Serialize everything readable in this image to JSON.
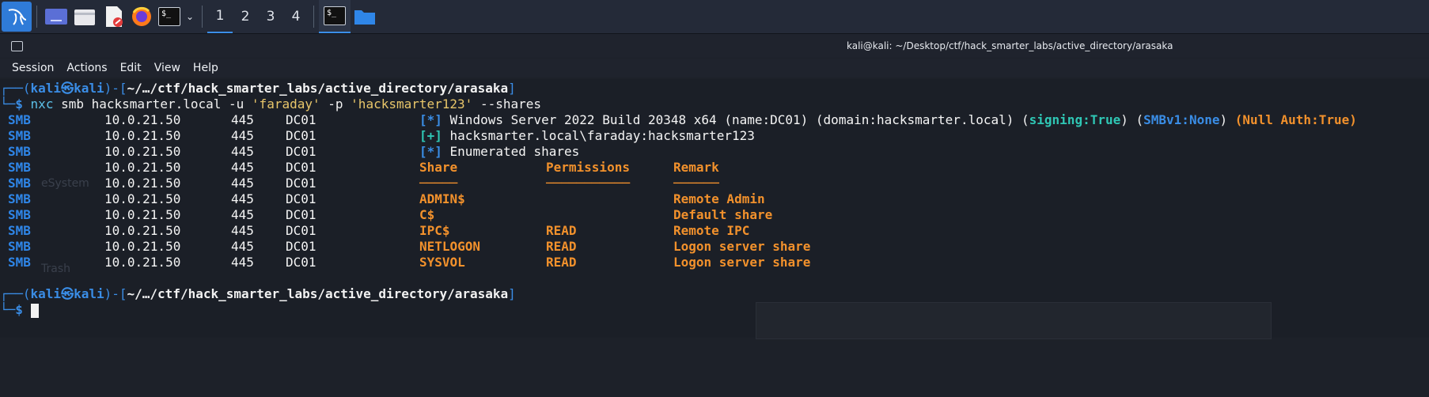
{
  "taskbar": {
    "apps": [
      {
        "name": "kali-menu-icon"
      },
      {
        "name": "show-desktop-icon"
      },
      {
        "name": "file-manager-icon"
      },
      {
        "name": "text-editor-icon"
      },
      {
        "name": "firefox-icon"
      },
      {
        "name": "terminal-icon"
      }
    ],
    "workspaces": [
      "1",
      "2",
      "3",
      "4"
    ],
    "active_workspace": "1",
    "terminal_mini_label": "$_"
  },
  "window": {
    "title": "kali@kali: ~/Desktop/ctf/hack_smarter_labs/active_directory/arasaka"
  },
  "menu": [
    "Session",
    "Actions",
    "Edit",
    "View",
    "Help"
  ],
  "terminal": {
    "prompt": {
      "user": "kali",
      "at": "㉿",
      "host": "kali",
      "path": "~/…/ctf/hack_smarter_labs/active_directory/arasaka",
      "dollar": "$"
    },
    "command": {
      "program": "nxc",
      "args_1": " smb hacksmarter.local ",
      "flag_u": "-u",
      "user_val": "'faraday'",
      "flag_p": "-p",
      "pass_val": "'hacksmarter123'",
      "flag_shares": "--shares"
    },
    "rows": [
      {
        "proto": "SMB",
        "ip": "10.0.21.50",
        "port": "445",
        "host": "DC01"
      },
      {
        "proto": "SMB",
        "ip": "10.0.21.50",
        "port": "445",
        "host": "DC01"
      },
      {
        "proto": "SMB",
        "ip": "10.0.21.50",
        "port": "445",
        "host": "DC01"
      },
      {
        "proto": "SMB",
        "ip": "10.0.21.50",
        "port": "445",
        "host": "DC01"
      },
      {
        "proto": "SMB",
        "ip": "10.0.21.50",
        "port": "445",
        "host": "DC01"
      },
      {
        "proto": "SMB",
        "ip": "10.0.21.50",
        "port": "445",
        "host": "DC01"
      },
      {
        "proto": "SMB",
        "ip": "10.0.21.50",
        "port": "445",
        "host": "DC01"
      },
      {
        "proto": "SMB",
        "ip": "10.0.21.50",
        "port": "445",
        "host": "DC01"
      },
      {
        "proto": "SMB",
        "ip": "10.0.21.50",
        "port": "445",
        "host": "DC01"
      },
      {
        "proto": "SMB",
        "ip": "10.0.21.50",
        "port": "445",
        "host": "DC01"
      }
    ],
    "info": {
      "tag_star": "[*]",
      "tag_plus": "[+]",
      "windows": " Windows Server 2022 Build 20348 x64 (name:DC01) (domain:hacksmarter.local) (",
      "signing": "signing:True",
      "mid": ") (",
      "smbv1": "SMBv1:None",
      "mid2": ") ",
      "null_auth": "(Null Auth:True)",
      "auth": " hacksmarter.local\\faraday:hacksmarter123",
      "enum": " Enumerated shares"
    },
    "share_header": {
      "share": "Share",
      "perm": "Permissions",
      "remark": "Remark"
    },
    "share_rule": {
      "share": "─────",
      "perm": "───────────",
      "remark": "──────"
    },
    "shares": [
      {
        "share": "ADMIN$",
        "perm": "",
        "remark": "Remote Admin"
      },
      {
        "share": "C$",
        "perm": "",
        "remark": "Default share"
      },
      {
        "share": "IPC$",
        "perm": "READ",
        "remark": "Remote IPC"
      },
      {
        "share": "NETLOGON",
        "perm": "READ",
        "remark": "Logon server share"
      },
      {
        "share": "SYSVOL",
        "perm": "READ",
        "remark": "Logon server share"
      }
    ]
  },
  "desktop_ghosts": {
    "system": "eSystem",
    "trash": "Trash"
  }
}
